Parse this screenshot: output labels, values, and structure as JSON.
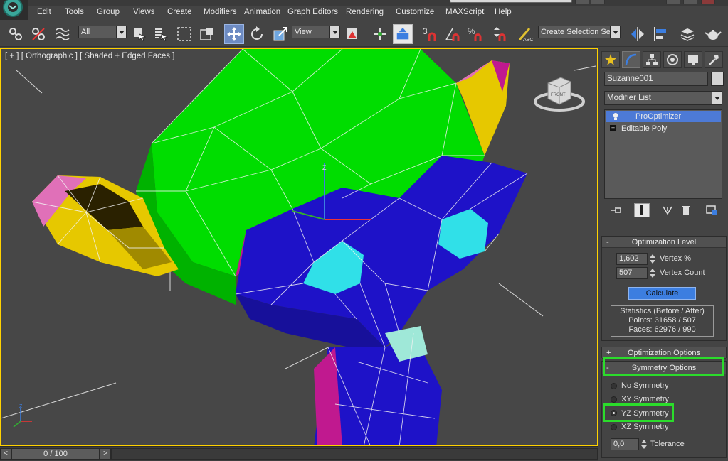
{
  "app": {
    "name": "3ds Max"
  },
  "menu": {
    "items": [
      {
        "label": "Edit"
      },
      {
        "label": "Tools"
      },
      {
        "label": "Group"
      },
      {
        "label": "Views"
      },
      {
        "label": "Create"
      },
      {
        "label": "Modifiers"
      },
      {
        "label": "Animation"
      },
      {
        "label": "Graph Editors"
      },
      {
        "label": "Rendering"
      },
      {
        "label": "Customize"
      },
      {
        "label": "MAXScript"
      },
      {
        "label": "Help"
      }
    ]
  },
  "toolbar": {
    "filter_select": "All",
    "ref_coord_select": "View",
    "named_selection_select": "Create Selection Se",
    "snap_labels": {
      "snap3d": "3",
      "angle": "",
      "percent": "%"
    }
  },
  "viewport": {
    "label": "[ + ] [ Orthographic ] [ Shaded + Edged Faces ]",
    "viewcube_face": "FRONT",
    "axis_z": "Z",
    "tripod": {
      "x": "X",
      "y": "Y",
      "z": "Z"
    }
  },
  "timeline": {
    "prev": "<",
    "position": "0 / 100",
    "next": ">"
  },
  "command_panel": {
    "object_name": "Suzanne001",
    "modifier_list": "Modifier List",
    "stack": [
      {
        "label": "ProOptimizer",
        "selected": true
      },
      {
        "label": "Editable Poly",
        "selected": false
      }
    ],
    "optimization_level": {
      "title": "Optimization Level",
      "sign": "-",
      "vertex_percent_value": "1,602",
      "vertex_percent_label": "Vertex %",
      "vertex_count_value": "507",
      "vertex_count_label": "Vertex Count",
      "calculate_label": "Calculate",
      "stats_title": "Statistics (Before / After)",
      "stats_points": "Points: 31658 / 507",
      "stats_faces": "Faces: 62976 / 990"
    },
    "optimization_options": {
      "title": "Optimization Options",
      "sign": "+"
    },
    "symmetry_options": {
      "title": "Symmetry Options",
      "sign": "-",
      "options": [
        {
          "label": "No Symmetry",
          "checked": false
        },
        {
          "label": "XY Symmetry",
          "checked": false
        },
        {
          "label": "YZ Symmetry",
          "checked": true
        },
        {
          "label": "XZ Symmetry",
          "checked": false
        }
      ],
      "tolerance_value": "0,0",
      "tolerance_label": "Tolerance"
    }
  },
  "colors": {
    "highlight": "#2bdc2b",
    "viewport_border": "#ffd200",
    "selected_stack": "#4d7ad6",
    "calculate_button": "#3c7ee0",
    "mesh_green": "#00dd00",
    "mesh_blue": "#1e12c8",
    "mesh_yellow": "#e6c800",
    "mesh_cyan": "#30e0e8",
    "mesh_magenta": "#c0198f"
  }
}
